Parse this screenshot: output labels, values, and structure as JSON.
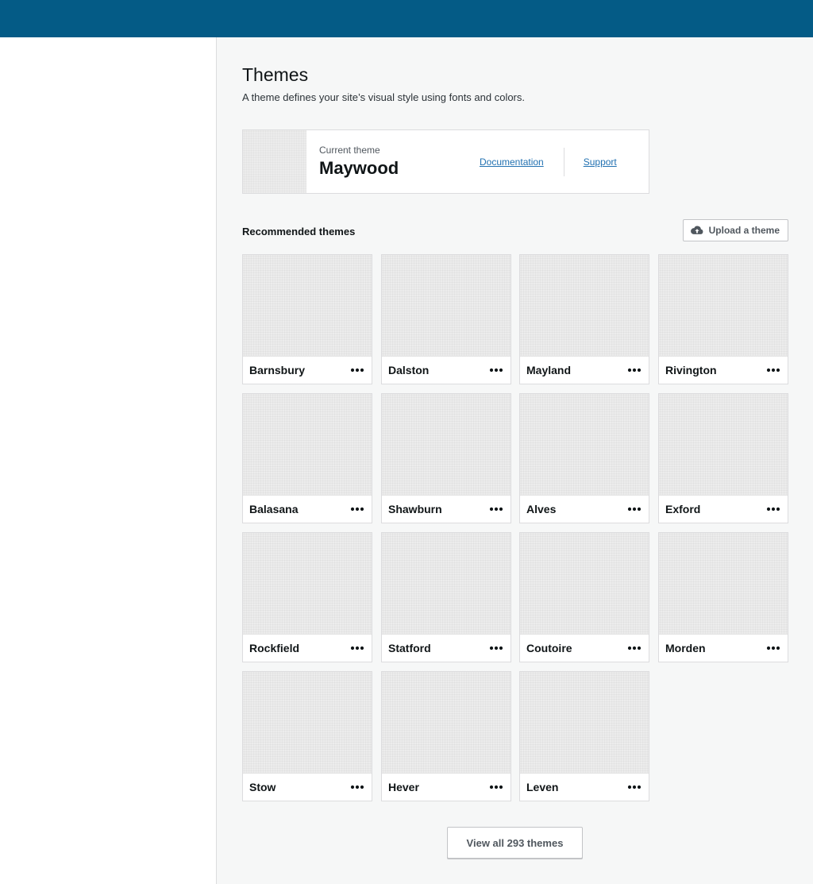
{
  "header": {
    "bar_color": "#045b86"
  },
  "page": {
    "title": "Themes",
    "description": "A theme defines your site’s visual style using fonts and colors."
  },
  "current_theme": {
    "label": "Current theme",
    "name": "Maywood",
    "documentation_link": "Documentation",
    "support_link": "Support"
  },
  "recommended": {
    "title": "Recommended themes",
    "upload_label": "Upload a theme",
    "upload_icon": "cloud-upload-icon",
    "more_icon": "ellipsis-icon",
    "themes": [
      {
        "name": "Barnsbury"
      },
      {
        "name": "Dalston"
      },
      {
        "name": "Mayland"
      },
      {
        "name": "Rivington"
      },
      {
        "name": "Balasana"
      },
      {
        "name": "Shawburn"
      },
      {
        "name": "Alves"
      },
      {
        "name": "Exford"
      },
      {
        "name": "Rockfield"
      },
      {
        "name": "Statford"
      },
      {
        "name": "Coutoire"
      },
      {
        "name": "Morden"
      },
      {
        "name": "Stow"
      },
      {
        "name": "Hever"
      },
      {
        "name": "Leven"
      }
    ],
    "view_all_label": "View all 293 themes"
  }
}
